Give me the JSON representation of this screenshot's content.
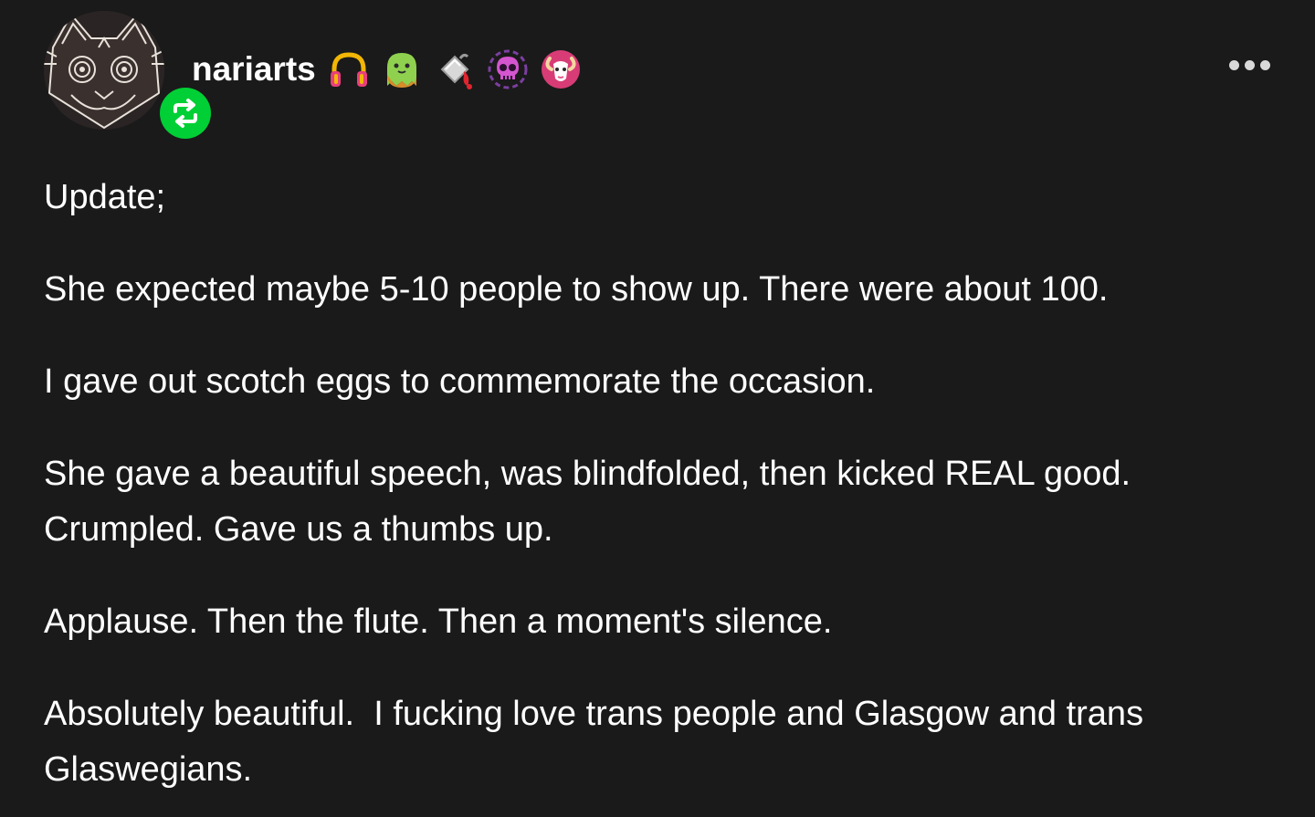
{
  "post": {
    "username": "nariarts",
    "badges": [
      {
        "icon": "headphones-icon",
        "color": "#f5c518"
      },
      {
        "icon": "ghost-icon",
        "color": "#7ac943"
      },
      {
        "icon": "paint-bucket-icon",
        "color": "#cfcfcf"
      },
      {
        "icon": "skull-icon",
        "color": "#c94fd8"
      },
      {
        "icon": "goat-icon",
        "color": "#e0457b"
      }
    ],
    "reblog_color": "#00cf35",
    "paragraphs": [
      "Update;",
      "She expected maybe 5-10 people to show up. There were about 100.",
      "I gave out scotch eggs to commemorate the occasion.",
      "She gave a beautiful speech, was blindfolded, then kicked REAL good. Crumpled. Gave us a thumbs up.",
      "Applause. Then the flute. Then a moment's silence.",
      "Absolutely beautiful.  I fucking love trans people and Glasgow and trans Glaswegians."
    ]
  }
}
